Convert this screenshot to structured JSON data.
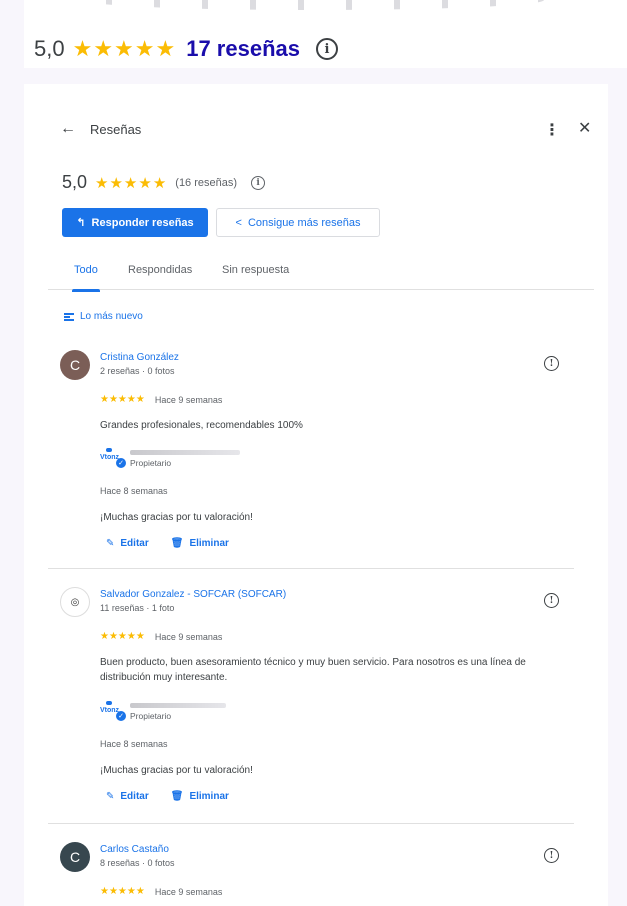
{
  "colors": {
    "accent": "#1a73e8",
    "star": "#fbbc04",
    "link": "#1a0dab"
  },
  "top_summary": {
    "rating": "5,0",
    "stars": "★★★★★",
    "count_link": "17 reseñas"
  },
  "panel": {
    "title": "Reseñas",
    "summary": {
      "rating": "5,0",
      "stars": "★★★★★",
      "count": "(16 reseñas)"
    },
    "buttons": {
      "reply": "Responder reseñas",
      "get_more": "Consigue más reseñas"
    },
    "tabs": [
      "Todo",
      "Respondidas",
      "Sin respuesta"
    ],
    "sort_label": "Lo más nuevo"
  },
  "reviews": [
    {
      "initial": "C",
      "avatar_color": "#7b5e57",
      "name": "Cristina González",
      "meta": "2 reseñas · 0 fotos",
      "stars": "★★★★★",
      "time": "Hace 9 semanas",
      "text": "Grandes profesionales, recomendables 100%",
      "owner_role": "Propietario",
      "owner_time": "Hace 8 semanas",
      "owner_reply": "¡Muchas gracias por tu valoración!",
      "edit": "Editar",
      "delete": "Eliminar"
    },
    {
      "initial": "",
      "avatar_color": "#ffffff",
      "name": "Salvador Gonzalez - SOFCAR (SOFCAR)",
      "meta": "11 reseñas · 1 foto",
      "stars": "★★★★★",
      "time": "Hace 9 semanas",
      "text": "Buen producto, buen asesoramiento técnico y muy buen servicio. Para nosotros es una línea de distribución muy interesante.",
      "owner_role": "Propietario",
      "owner_time": "Hace 8 semanas",
      "owner_reply": "¡Muchas gracias por tu valoración!",
      "edit": "Editar",
      "delete": "Eliminar"
    },
    {
      "initial": "C",
      "avatar_color": "#37474f",
      "name": "Carlos Castaño",
      "meta": "8 reseñas · 0 fotos",
      "stars": "★★★★★",
      "time": "Hace 9 semanas"
    }
  ]
}
